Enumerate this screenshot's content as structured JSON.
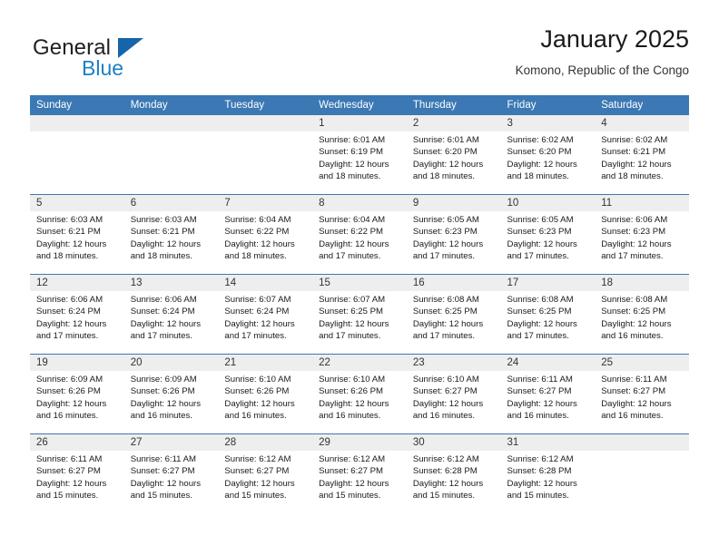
{
  "brand": {
    "word_one": "General",
    "word_two": "Blue",
    "triangle_icon": "brand-triangle-icon"
  },
  "header": {
    "title": "January 2025",
    "subtitle": "Komono, Republic of the Congo"
  },
  "colors": {
    "header_blue": "#3b78b4",
    "brand_blue": "#1f7fc4",
    "daynum_gray": "#eeeeee"
  },
  "calendar": {
    "weekday_headers": [
      "Sunday",
      "Monday",
      "Tuesday",
      "Wednesday",
      "Thursday",
      "Friday",
      "Saturday"
    ],
    "weeks": [
      [
        {
          "day": "",
          "sunrise": "",
          "sunset": "",
          "daylight_line1": "",
          "daylight_line2": ""
        },
        {
          "day": "",
          "sunrise": "",
          "sunset": "",
          "daylight_line1": "",
          "daylight_line2": ""
        },
        {
          "day": "",
          "sunrise": "",
          "sunset": "",
          "daylight_line1": "",
          "daylight_line2": ""
        },
        {
          "day": "1",
          "sunrise": "Sunrise: 6:01 AM",
          "sunset": "Sunset: 6:19 PM",
          "daylight_line1": "Daylight: 12 hours",
          "daylight_line2": "and 18 minutes."
        },
        {
          "day": "2",
          "sunrise": "Sunrise: 6:01 AM",
          "sunset": "Sunset: 6:20 PM",
          "daylight_line1": "Daylight: 12 hours",
          "daylight_line2": "and 18 minutes."
        },
        {
          "day": "3",
          "sunrise": "Sunrise: 6:02 AM",
          "sunset": "Sunset: 6:20 PM",
          "daylight_line1": "Daylight: 12 hours",
          "daylight_line2": "and 18 minutes."
        },
        {
          "day": "4",
          "sunrise": "Sunrise: 6:02 AM",
          "sunset": "Sunset: 6:21 PM",
          "daylight_line1": "Daylight: 12 hours",
          "daylight_line2": "and 18 minutes."
        }
      ],
      [
        {
          "day": "5",
          "sunrise": "Sunrise: 6:03 AM",
          "sunset": "Sunset: 6:21 PM",
          "daylight_line1": "Daylight: 12 hours",
          "daylight_line2": "and 18 minutes."
        },
        {
          "day": "6",
          "sunrise": "Sunrise: 6:03 AM",
          "sunset": "Sunset: 6:21 PM",
          "daylight_line1": "Daylight: 12 hours",
          "daylight_line2": "and 18 minutes."
        },
        {
          "day": "7",
          "sunrise": "Sunrise: 6:04 AM",
          "sunset": "Sunset: 6:22 PM",
          "daylight_line1": "Daylight: 12 hours",
          "daylight_line2": "and 18 minutes."
        },
        {
          "day": "8",
          "sunrise": "Sunrise: 6:04 AM",
          "sunset": "Sunset: 6:22 PM",
          "daylight_line1": "Daylight: 12 hours",
          "daylight_line2": "and 17 minutes."
        },
        {
          "day": "9",
          "sunrise": "Sunrise: 6:05 AM",
          "sunset": "Sunset: 6:23 PM",
          "daylight_line1": "Daylight: 12 hours",
          "daylight_line2": "and 17 minutes."
        },
        {
          "day": "10",
          "sunrise": "Sunrise: 6:05 AM",
          "sunset": "Sunset: 6:23 PM",
          "daylight_line1": "Daylight: 12 hours",
          "daylight_line2": "and 17 minutes."
        },
        {
          "day": "11",
          "sunrise": "Sunrise: 6:06 AM",
          "sunset": "Sunset: 6:23 PM",
          "daylight_line1": "Daylight: 12 hours",
          "daylight_line2": "and 17 minutes."
        }
      ],
      [
        {
          "day": "12",
          "sunrise": "Sunrise: 6:06 AM",
          "sunset": "Sunset: 6:24 PM",
          "daylight_line1": "Daylight: 12 hours",
          "daylight_line2": "and 17 minutes."
        },
        {
          "day": "13",
          "sunrise": "Sunrise: 6:06 AM",
          "sunset": "Sunset: 6:24 PM",
          "daylight_line1": "Daylight: 12 hours",
          "daylight_line2": "and 17 minutes."
        },
        {
          "day": "14",
          "sunrise": "Sunrise: 6:07 AM",
          "sunset": "Sunset: 6:24 PM",
          "daylight_line1": "Daylight: 12 hours",
          "daylight_line2": "and 17 minutes."
        },
        {
          "day": "15",
          "sunrise": "Sunrise: 6:07 AM",
          "sunset": "Sunset: 6:25 PM",
          "daylight_line1": "Daylight: 12 hours",
          "daylight_line2": "and 17 minutes."
        },
        {
          "day": "16",
          "sunrise": "Sunrise: 6:08 AM",
          "sunset": "Sunset: 6:25 PM",
          "daylight_line1": "Daylight: 12 hours",
          "daylight_line2": "and 17 minutes."
        },
        {
          "day": "17",
          "sunrise": "Sunrise: 6:08 AM",
          "sunset": "Sunset: 6:25 PM",
          "daylight_line1": "Daylight: 12 hours",
          "daylight_line2": "and 17 minutes."
        },
        {
          "day": "18",
          "sunrise": "Sunrise: 6:08 AM",
          "sunset": "Sunset: 6:25 PM",
          "daylight_line1": "Daylight: 12 hours",
          "daylight_line2": "and 16 minutes."
        }
      ],
      [
        {
          "day": "19",
          "sunrise": "Sunrise: 6:09 AM",
          "sunset": "Sunset: 6:26 PM",
          "daylight_line1": "Daylight: 12 hours",
          "daylight_line2": "and 16 minutes."
        },
        {
          "day": "20",
          "sunrise": "Sunrise: 6:09 AM",
          "sunset": "Sunset: 6:26 PM",
          "daylight_line1": "Daylight: 12 hours",
          "daylight_line2": "and 16 minutes."
        },
        {
          "day": "21",
          "sunrise": "Sunrise: 6:10 AM",
          "sunset": "Sunset: 6:26 PM",
          "daylight_line1": "Daylight: 12 hours",
          "daylight_line2": "and 16 minutes."
        },
        {
          "day": "22",
          "sunrise": "Sunrise: 6:10 AM",
          "sunset": "Sunset: 6:26 PM",
          "daylight_line1": "Daylight: 12 hours",
          "daylight_line2": "and 16 minutes."
        },
        {
          "day": "23",
          "sunrise": "Sunrise: 6:10 AM",
          "sunset": "Sunset: 6:27 PM",
          "daylight_line1": "Daylight: 12 hours",
          "daylight_line2": "and 16 minutes."
        },
        {
          "day": "24",
          "sunrise": "Sunrise: 6:11 AM",
          "sunset": "Sunset: 6:27 PM",
          "daylight_line1": "Daylight: 12 hours",
          "daylight_line2": "and 16 minutes."
        },
        {
          "day": "25",
          "sunrise": "Sunrise: 6:11 AM",
          "sunset": "Sunset: 6:27 PM",
          "daylight_line1": "Daylight: 12 hours",
          "daylight_line2": "and 16 minutes."
        }
      ],
      [
        {
          "day": "26",
          "sunrise": "Sunrise: 6:11 AM",
          "sunset": "Sunset: 6:27 PM",
          "daylight_line1": "Daylight: 12 hours",
          "daylight_line2": "and 15 minutes."
        },
        {
          "day": "27",
          "sunrise": "Sunrise: 6:11 AM",
          "sunset": "Sunset: 6:27 PM",
          "daylight_line1": "Daylight: 12 hours",
          "daylight_line2": "and 15 minutes."
        },
        {
          "day": "28",
          "sunrise": "Sunrise: 6:12 AM",
          "sunset": "Sunset: 6:27 PM",
          "daylight_line1": "Daylight: 12 hours",
          "daylight_line2": "and 15 minutes."
        },
        {
          "day": "29",
          "sunrise": "Sunrise: 6:12 AM",
          "sunset": "Sunset: 6:27 PM",
          "daylight_line1": "Daylight: 12 hours",
          "daylight_line2": "and 15 minutes."
        },
        {
          "day": "30",
          "sunrise": "Sunrise: 6:12 AM",
          "sunset": "Sunset: 6:28 PM",
          "daylight_line1": "Daylight: 12 hours",
          "daylight_line2": "and 15 minutes."
        },
        {
          "day": "31",
          "sunrise": "Sunrise: 6:12 AM",
          "sunset": "Sunset: 6:28 PM",
          "daylight_line1": "Daylight: 12 hours",
          "daylight_line2": "and 15 minutes."
        },
        {
          "day": "",
          "sunrise": "",
          "sunset": "",
          "daylight_line1": "",
          "daylight_line2": ""
        }
      ]
    ]
  }
}
